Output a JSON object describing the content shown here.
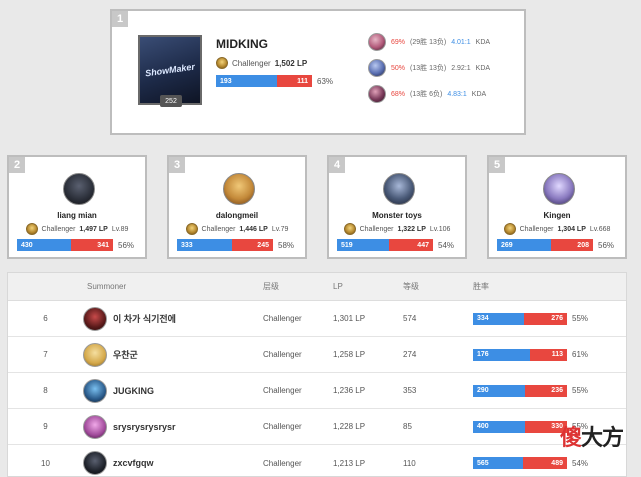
{
  "top": {
    "rank": "1",
    "name": "MIDKING",
    "tier_text": "Challenger",
    "lp_text": "1,502 LP",
    "level": "252",
    "icon_text": "ShowMaker",
    "wins": "193",
    "losses": "111",
    "win_fraction": 0.635,
    "winrate": "63%",
    "champions": [
      {
        "winrate": "69%",
        "record": "(29胜 13负)",
        "kda": "4.01:1",
        "kda_label": "KDA",
        "color": "#b25a7a"
      },
      {
        "winrate": "50%",
        "record": "(13胜 13负)",
        "kda": "2.92:1",
        "kda_label": "KDA",
        "color": "#5a6fb2"
      },
      {
        "winrate": "68%",
        "record": "(13胜 6负)",
        "kda": "4.83:1",
        "kda_label": "KDA",
        "color": "#7a3a5a"
      }
    ]
  },
  "cards": [
    {
      "rank": "2",
      "name": "liang mian",
      "tier": "Challenger",
      "lp": "1,497 LP",
      "lv": "Lv.89",
      "wins": "430",
      "losses": "341",
      "win_fraction": 0.558,
      "winrate": "56%",
      "color": "#2a2e38"
    },
    {
      "rank": "3",
      "name": "dalongmeil",
      "tier": "Challenger",
      "lp": "1,446 LP",
      "lv": "Lv.79",
      "wins": "333",
      "losses": "245",
      "win_fraction": 0.576,
      "winrate": "58%",
      "color": "#c48a3a"
    },
    {
      "rank": "4",
      "name": "Monster toys",
      "tier": "Challenger",
      "lp": "1,322 LP",
      "lv": "Lv.106",
      "wins": "519",
      "losses": "447",
      "win_fraction": 0.537,
      "winrate": "54%",
      "color": "#4a5a78"
    },
    {
      "rank": "5",
      "name": "Kingen",
      "tier": "Challenger",
      "lp": "1,304 LP",
      "lv": "Lv.668",
      "wins": "269",
      "losses": "208",
      "win_fraction": 0.564,
      "winrate": "56%",
      "color": "#8a7ac0"
    }
  ],
  "table": {
    "headers": {
      "summoner": "Summoner",
      "tier": "层级",
      "lp": "LP",
      "level": "等级",
      "winrate": "胜率"
    },
    "rows": [
      {
        "rank": "6",
        "name": "이 차가 식기전에",
        "tier": "Challenger",
        "lp": "1,301 LP",
        "level": "574",
        "wins": "334",
        "losses": "276",
        "win_fraction": 0.547,
        "winrate": "55%",
        "color": "#5a1a1a"
      },
      {
        "rank": "7",
        "name": "우찬군",
        "tier": "Challenger",
        "lp": "1,258 LP",
        "level": "274",
        "wins": "176",
        "losses": "113",
        "win_fraction": 0.609,
        "winrate": "61%",
        "color": "#d4a84a"
      },
      {
        "rank": "8",
        "name": "JUGKING",
        "tier": "Challenger",
        "lp": "1,236 LP",
        "level": "353",
        "wins": "290",
        "losses": "236",
        "win_fraction": 0.551,
        "winrate": "55%",
        "color": "#2a5a8a"
      },
      {
        "rank": "9",
        "name": "srysrysrysrysr",
        "tier": "Challenger",
        "lp": "1,228 LP",
        "level": "85",
        "wins": "400",
        "losses": "330",
        "win_fraction": 0.548,
        "winrate": "55%",
        "color": "#a04a9a"
      },
      {
        "rank": "10",
        "name": "zxcvfgqw",
        "tier": "Challenger",
        "lp": "1,213 LP",
        "level": "110",
        "wins": "565",
        "losses": "489",
        "win_fraction": 0.536,
        "winrate": "54%",
        "color": "#1e222a"
      }
    ]
  },
  "watermark": {
    "char1": "傻",
    "char2": "大方"
  }
}
